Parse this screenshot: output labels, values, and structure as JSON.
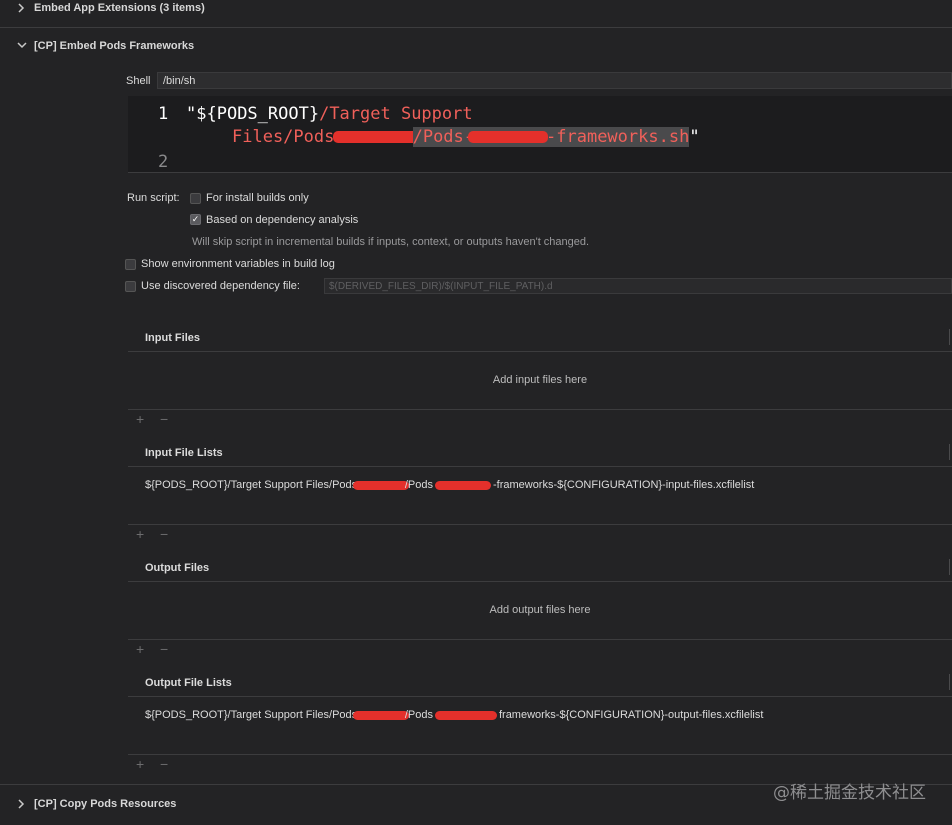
{
  "phases": {
    "embed_app_ext": {
      "title": "Embed App Extensions (3 items)"
    },
    "embed_pods": {
      "title": "[CP] Embed Pods Frameworks"
    },
    "copy_pods": {
      "title": "[CP] Copy Pods Resources"
    }
  },
  "shell": {
    "label": "Shell",
    "value": "/bin/sh"
  },
  "script": {
    "line1_no": "1",
    "line2_no": "2",
    "quote_open": "\"",
    "var": "${PODS_ROOT}",
    "path1": "/Target Support",
    "path2a": "Files/Pods-",
    "path2b": "/Pods-",
    "path2c": "-frameworks.sh",
    "quote_close": "\""
  },
  "options": {
    "run_script_label": "Run script:",
    "install_builds_only": {
      "label": "For install builds only",
      "checked": false
    },
    "dependency_analysis": {
      "label": "Based on dependency analysis",
      "checked": true
    },
    "skip_note": "Will skip script in incremental builds if inputs, context, or outputs haven't changed.",
    "show_env": {
      "label": "Show environment variables in build log",
      "checked": false
    },
    "discovered_dep": {
      "label": "Use discovered dependency file:",
      "checked": false,
      "placeholder": "$(DERIVED_FILES_DIR)/$(INPUT_FILE_PATH).d"
    }
  },
  "sections": {
    "input_files": {
      "title": "Input Files",
      "placeholder": "Add input files here"
    },
    "input_file_lists": {
      "title": "Input File Lists",
      "row_a": "${PODS_ROOT}/Target Support Files/Pods-",
      "row_b": "/Pods",
      "row_c": "-frameworks-${CONFIGURATION}-input-files.xcfilelist"
    },
    "output_files": {
      "title": "Output Files",
      "placeholder": "Add output files here"
    },
    "output_file_lists": {
      "title": "Output File Lists",
      "row_a": "${PODS_ROOT}/Target Support Files/Pods-",
      "row_b": "/Pods",
      "row_c": "frameworks-${CONFIGURATION}-output-files.xcfilelist"
    }
  },
  "controls": {
    "plus": "+",
    "minus": "−"
  },
  "icons": {
    "chevron_right": "›",
    "chevron_down": "⌄",
    "checkmark": "✓"
  },
  "watermark": "@稀土掘金技术社区",
  "colors": {
    "background": "#232325",
    "code_red": "#f0605a",
    "redaction": "#e4302b",
    "selection": "#4a4a4c"
  }
}
